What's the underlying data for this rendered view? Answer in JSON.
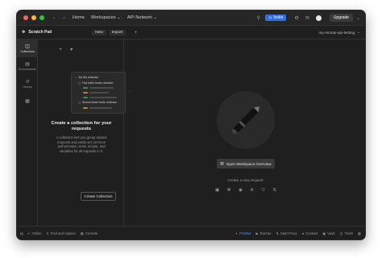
{
  "colors": {
    "accent": "#2f6fe0",
    "window_bg": "#1f1f1f",
    "mac_close": "#ff5f57",
    "mac_minimize": "#febc2e",
    "mac_maximize": "#28c840",
    "illustration_orange": "#c47a2c",
    "illustration_green": "#3f8a57"
  },
  "header": {
    "home_label": "Home",
    "workspaces_label": "Workspaces",
    "api_network_label": "API Network",
    "invite_label": "Invite",
    "upgrade_label": "Upgrade"
  },
  "workspace": {
    "name": "Scratch Pad",
    "new_label": "New",
    "import_label": "Import",
    "environment_label": "my-remote-api-testing"
  },
  "rail": {
    "items": [
      {
        "label": "Collections",
        "icon": "trash-can-icon"
      },
      {
        "label": "Environments",
        "icon": "environment-icon"
      },
      {
        "label": "History",
        "icon": "history-icon"
      },
      {
        "label": "",
        "icon": "apps-icon"
      }
    ]
  },
  "illustration": {
    "collection_name": "My first collection",
    "folder1": "First folder inside collection",
    "folder2": "Second folder inside collection"
  },
  "empty_state": {
    "title": "Create a collection for your requests",
    "description": "A collection lets you group related requests and easily set common authorization, tests, scripts, and variables for all requests in it.",
    "create_button": "Create Collection"
  },
  "main": {
    "overview_button": "Open Workspace Overview",
    "create_request_label": "Create a new request:"
  },
  "status": {
    "online": "Online",
    "find_replace": "Find and replace",
    "console": "Console",
    "postbot": "Postbot",
    "runner": "Runner",
    "start_proxy": "Start Proxy",
    "cookies": "Cookies",
    "vault": "Vault",
    "trash": "Trash"
  }
}
